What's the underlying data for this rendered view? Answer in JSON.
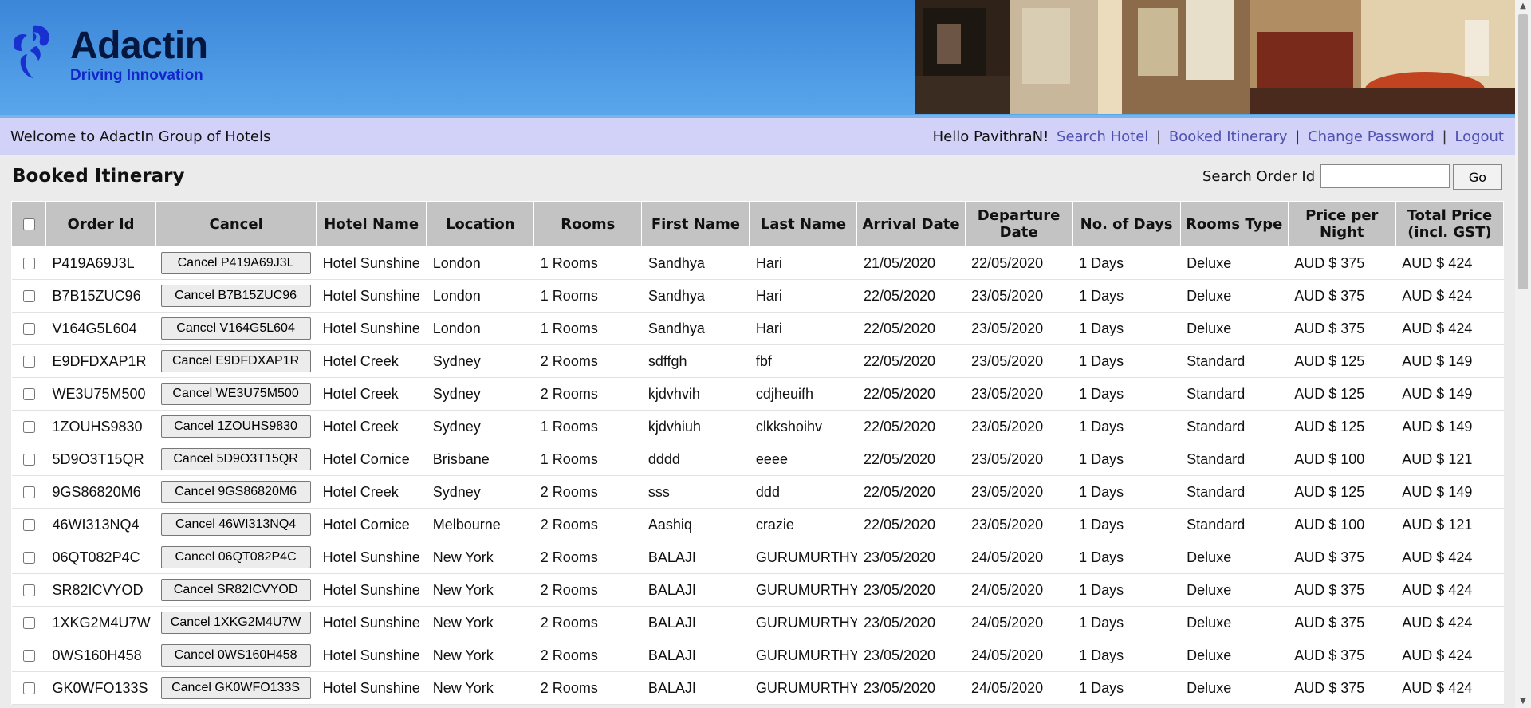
{
  "logo": {
    "title": "Adactin",
    "subtitle": "Driving Innovation"
  },
  "nav": {
    "welcome": "Welcome to AdactIn Group of Hotels",
    "hello": "Hello PavithraN!",
    "links": [
      "Search Hotel",
      "Booked Itinerary",
      "Change Password",
      "Logout"
    ],
    "separator": "|"
  },
  "page": {
    "title": "Booked Itinerary"
  },
  "search": {
    "label": "Search Order Id",
    "value": "",
    "go_label": "Go"
  },
  "table": {
    "headers": [
      "Order Id",
      "Cancel",
      "Hotel Name",
      "Location",
      "Rooms",
      "First Name",
      "Last Name",
      "Arrival Date",
      "Departure Date",
      "No. of Days",
      "Rooms Type",
      "Price per Night",
      "Total Price (incl. GST)"
    ],
    "rows": [
      {
        "order_id": "P419A69J3L",
        "cancel": "Cancel P419A69J3L",
        "hotel": "Hotel Sunshine",
        "location": "London",
        "rooms": "1 Rooms",
        "first": "Sandhya",
        "last": "Hari",
        "arrival": "21/05/2020",
        "departure": "22/05/2020",
        "days": "1 Days",
        "type": "Deluxe",
        "price": "AUD $ 375",
        "total": "AUD $ 424"
      },
      {
        "order_id": "B7B15ZUC96",
        "cancel": "Cancel B7B15ZUC96",
        "hotel": "Hotel Sunshine",
        "location": "London",
        "rooms": "1 Rooms",
        "first": "Sandhya",
        "last": "Hari",
        "arrival": "22/05/2020",
        "departure": "23/05/2020",
        "days": "1 Days",
        "type": "Deluxe",
        "price": "AUD $ 375",
        "total": "AUD $ 424"
      },
      {
        "order_id": "V164G5L604",
        "cancel": "Cancel V164G5L604",
        "hotel": "Hotel Sunshine",
        "location": "London",
        "rooms": "1 Rooms",
        "first": "Sandhya",
        "last": "Hari",
        "arrival": "22/05/2020",
        "departure": "23/05/2020",
        "days": "1 Days",
        "type": "Deluxe",
        "price": "AUD $ 375",
        "total": "AUD $ 424"
      },
      {
        "order_id": "E9DFDXAP1R",
        "cancel": "Cancel E9DFDXAP1R",
        "hotel": "Hotel Creek",
        "location": "Sydney",
        "rooms": "2 Rooms",
        "first": "sdffgh",
        "last": "fbf",
        "arrival": "22/05/2020",
        "departure": "23/05/2020",
        "days": "1 Days",
        "type": "Standard",
        "price": "AUD $ 125",
        "total": "AUD $ 149"
      },
      {
        "order_id": "WE3U75M500",
        "cancel": "Cancel WE3U75M500",
        "hotel": "Hotel Creek",
        "location": "Sydney",
        "rooms": "2 Rooms",
        "first": "kjdvhvih",
        "last": "cdjheuifh",
        "arrival": "22/05/2020",
        "departure": "23/05/2020",
        "days": "1 Days",
        "type": "Standard",
        "price": "AUD $ 125",
        "total": "AUD $ 149"
      },
      {
        "order_id": "1ZOUHS9830",
        "cancel": "Cancel 1ZOUHS9830",
        "hotel": "Hotel Creek",
        "location": "Sydney",
        "rooms": "1 Rooms",
        "first": "kjdvhiuh",
        "last": "clkkshoihv",
        "arrival": "22/05/2020",
        "departure": "23/05/2020",
        "days": "1 Days",
        "type": "Standard",
        "price": "AUD $ 125",
        "total": "AUD $ 149"
      },
      {
        "order_id": "5D9O3T15QR",
        "cancel": "Cancel 5D9O3T15QR",
        "hotel": "Hotel Cornice",
        "location": "Brisbane",
        "rooms": "1 Rooms",
        "first": "dddd",
        "last": "eeee",
        "arrival": "22/05/2020",
        "departure": "23/05/2020",
        "days": "1 Days",
        "type": "Standard",
        "price": "AUD $ 100",
        "total": "AUD $ 121"
      },
      {
        "order_id": "9GS86820M6",
        "cancel": "Cancel 9GS86820M6",
        "hotel": "Hotel Creek",
        "location": "Sydney",
        "rooms": "2 Rooms",
        "first": "sss",
        "last": "ddd",
        "arrival": "22/05/2020",
        "departure": "23/05/2020",
        "days": "1 Days",
        "type": "Standard",
        "price": "AUD $ 125",
        "total": "AUD $ 149"
      },
      {
        "order_id": "46WI313NQ4",
        "cancel": "Cancel 46WI313NQ4",
        "hotel": "Hotel Cornice",
        "location": "Melbourne",
        "rooms": "2 Rooms",
        "first": "Aashiq",
        "last": "crazie",
        "arrival": "22/05/2020",
        "departure": "23/05/2020",
        "days": "1 Days",
        "type": "Standard",
        "price": "AUD $ 100",
        "total": "AUD $ 121"
      },
      {
        "order_id": "06QT082P4C",
        "cancel": "Cancel 06QT082P4C",
        "hotel": "Hotel Sunshine",
        "location": "New York",
        "rooms": "2 Rooms",
        "first": "BALAJI",
        "last": "GURUMURTHY",
        "arrival": "23/05/2020",
        "departure": "24/05/2020",
        "days": "1 Days",
        "type": "Deluxe",
        "price": "AUD $ 375",
        "total": "AUD $ 424"
      },
      {
        "order_id": "SR82ICVYOD",
        "cancel": "Cancel SR82ICVYOD",
        "hotel": "Hotel Sunshine",
        "location": "New York",
        "rooms": "2 Rooms",
        "first": "BALAJI",
        "last": "GURUMURTHY",
        "arrival": "23/05/2020",
        "departure": "24/05/2020",
        "days": "1 Days",
        "type": "Deluxe",
        "price": "AUD $ 375",
        "total": "AUD $ 424"
      },
      {
        "order_id": "1XKG2M4U7W",
        "cancel": "Cancel 1XKG2M4U7W",
        "hotel": "Hotel Sunshine",
        "location": "New York",
        "rooms": "2 Rooms",
        "first": "BALAJI",
        "last": "GURUMURTHY",
        "arrival": "23/05/2020",
        "departure": "24/05/2020",
        "days": "1 Days",
        "type": "Deluxe",
        "price": "AUD $ 375",
        "total": "AUD $ 424"
      },
      {
        "order_id": "0WS160H458",
        "cancel": "Cancel 0WS160H458",
        "hotel": "Hotel Sunshine",
        "location": "New York",
        "rooms": "2 Rooms",
        "first": "BALAJI",
        "last": "GURUMURTHY",
        "arrival": "23/05/2020",
        "departure": "24/05/2020",
        "days": "1 Days",
        "type": "Deluxe",
        "price": "AUD $ 375",
        "total": "AUD $ 424"
      },
      {
        "order_id": "GK0WFO133S",
        "cancel": "Cancel GK0WFO133S",
        "hotel": "Hotel Sunshine",
        "location": "New York",
        "rooms": "2 Rooms",
        "first": "BALAJI",
        "last": "GURUMURTHY",
        "arrival": "23/05/2020",
        "departure": "24/05/2020",
        "days": "1 Days",
        "type": "Deluxe",
        "price": "AUD $ 375",
        "total": "AUD $ 424"
      }
    ]
  },
  "colors": {
    "header": "#4a98e4",
    "navbar": "#d2d2f9",
    "link": "#5050b0",
    "table_header": "#c3c3c3"
  }
}
